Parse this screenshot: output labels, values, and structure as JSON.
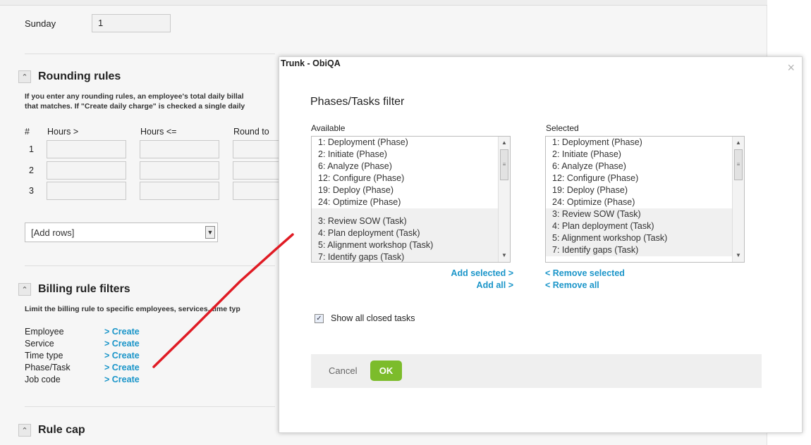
{
  "background": {
    "days": [
      {
        "label": "Sunday",
        "value": "1"
      }
    ],
    "rounding": {
      "title": "Rounding rules",
      "desc_line1": "If you enter any rounding rules, an employee's total daily billal",
      "desc_line2": "that matches. If \"Create daily charge\" is checked a single daily",
      "headers": [
        "#",
        "Hours >",
        "Hours <=",
        "Round to"
      ],
      "rows": [
        "1",
        "2",
        "3"
      ],
      "add_rows": "[Add rows]"
    },
    "billing": {
      "title": "Billing rule filters",
      "desc": "Limit the billing rule to specific employees, services, time typ",
      "items": [
        {
          "label": "Employee",
          "link": "> Create"
        },
        {
          "label": "Service",
          "link": "> Create"
        },
        {
          "label": "Time type",
          "link": "> Create"
        },
        {
          "label": "Phase/Task",
          "link": "> Create"
        },
        {
          "label": "Job code",
          "link": "> Create"
        }
      ]
    },
    "rule_cap": {
      "title": "Rule cap"
    }
  },
  "modal": {
    "window_title": "Trunk - ObiQA",
    "close_glyph": "×",
    "heading": "Phases/Tasks filter",
    "available_label": "Available",
    "selected_label": "Selected",
    "available": [
      "1: Deployment (Phase)",
      "2: Initiate (Phase)",
      "6: Analyze (Phase)",
      "12: Configure (Phase)",
      "19: Deploy (Phase)",
      "24: Optimize (Phase)",
      "",
      "3: Review SOW (Task)",
      "4: Plan deployment (Task)",
      "5: Alignment workshop (Task)",
      "7: Identify gaps (Task)"
    ],
    "selected": [
      "1: Deployment (Phase)",
      "2: Initiate (Phase)",
      "6: Analyze (Phase)",
      "12: Configure (Phase)",
      "19: Deploy (Phase)",
      "24: Optimize (Phase)",
      "3: Review SOW (Task)",
      "4: Plan deployment (Task)",
      "5: Alignment workshop (Task)",
      "7: Identify gaps (Task)"
    ],
    "add_selected": "Add selected >",
    "add_all": "Add all >",
    "remove_selected": "< Remove selected",
    "remove_all": "< Remove all",
    "show_closed_label": "Show all closed tasks",
    "show_closed_checked": true,
    "cancel_label": "Cancel",
    "ok_label": "OK"
  },
  "colors": {
    "link": "#1a95c9",
    "ok_button": "#7cbc2b",
    "annotation": "#e01b24"
  },
  "icons": {
    "collapse": "double-chevron-up-icon",
    "dropdown": "dropdown-arrow-icon",
    "scroll": "scrollbar-arrow-icon"
  }
}
